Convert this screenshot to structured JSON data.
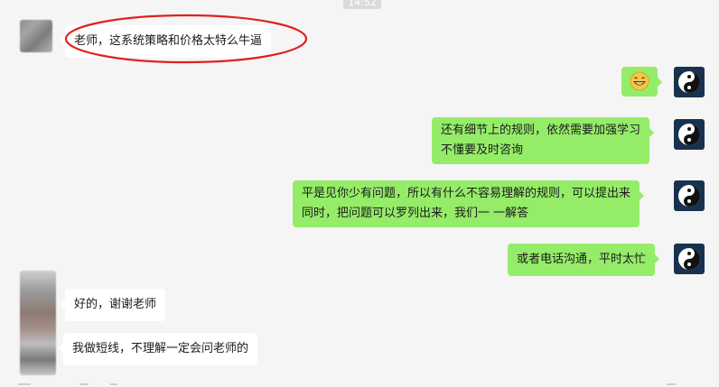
{
  "header": {
    "time": "14:52"
  },
  "messages": [
    {
      "side": "in",
      "text": "老师，这系统策略和价格太特么牛逼"
    },
    {
      "side": "out",
      "emoji": "grinning-face-emoji"
    },
    {
      "side": "out",
      "lines": [
        "还有细节上的规则，依然需要加强学习",
        "不懂要及时咨询"
      ]
    },
    {
      "side": "out",
      "lines": [
        "平是见你少有问题，所以有什么不容易理解的规则，可以提出来",
        "同时，把问题可以罗列出来，我们一 一解答"
      ]
    },
    {
      "side": "out",
      "text": "或者电话沟通，平时太忙"
    },
    {
      "side": "in",
      "text": "好的，谢谢老师"
    },
    {
      "side": "in",
      "text": "我做短线，不理解一定会问老师的"
    }
  ],
  "colors": {
    "background": "#f5f5f5",
    "outgoing_bubble": "#95ec69",
    "incoming_bubble": "#ffffff",
    "annotation_circle": "#e02020",
    "avatar_bg": "#17324e"
  },
  "icons": {
    "self_avatar": "yin-yang-icon",
    "contact_avatar": "blurred-avatar"
  }
}
